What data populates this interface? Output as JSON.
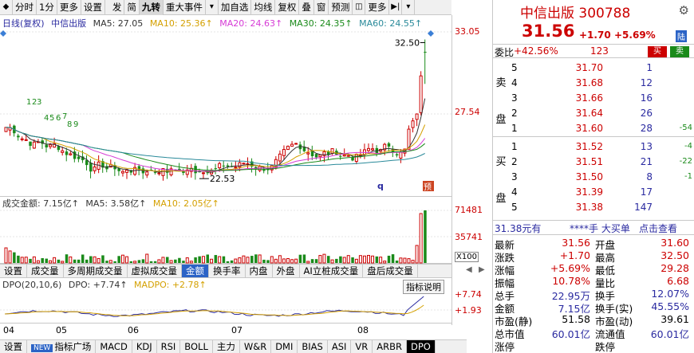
{
  "toolbar": {
    "items": [
      {
        "label": "◆",
        "kind": "arrow"
      },
      {
        "label": "分时"
      },
      {
        "label": "1分"
      },
      {
        "label": "更多"
      },
      {
        "label": "设置"
      },
      {
        "label": "",
        "kind": "gap"
      },
      {
        "label": "发"
      },
      {
        "label": "简"
      },
      {
        "label": "九转",
        "selected": true
      },
      {
        "label": "重大事件"
      },
      {
        "label": "▾",
        "kind": "arrow"
      },
      {
        "label": "加自选"
      },
      {
        "label": "均线"
      },
      {
        "label": "复权"
      },
      {
        "label": "叠"
      },
      {
        "label": "窗"
      },
      {
        "label": "预测"
      },
      {
        "label": "◫",
        "kind": "arrow"
      },
      {
        "label": "更多"
      },
      {
        "label": "▶|",
        "kind": "arrow"
      },
      {
        "label": "▾",
        "kind": "arrow"
      }
    ]
  },
  "kline": {
    "legend": {
      "mode": "日线(复权)",
      "name": "中信出版",
      "ma5": "MA5: 27.05",
      "ma10": "MA10: 25.36↑",
      "ma20": "MA20: 24.63↑",
      "ma30": "MA30: 24.35↑",
      "ma60": "MA60: 24.55↑"
    },
    "y_labels": [
      "33.05",
      "27.54"
    ],
    "high_label": "32.50",
    "low_label": "22.53",
    "nine_turn_labels": [
      "1",
      "2",
      "3",
      "4",
      "5",
      "6",
      "7",
      "8",
      "9"
    ],
    "marker_q": "q",
    "marker_box": "预"
  },
  "volume": {
    "legend": {
      "title": "成交金额: 7.15亿↑",
      "ma5": "MA5: 3.58亿↑",
      "ma10": "MA10: 2.05亿↑"
    },
    "y_labels": [
      "71481",
      "35741"
    ],
    "unit": "X100"
  },
  "subtabs": [
    {
      "label": "设置"
    },
    {
      "label": "成交量"
    },
    {
      "label": "多周期成交量"
    },
    {
      "label": "虚拟成交量"
    },
    {
      "label": "金额",
      "selected": true
    },
    {
      "label": "换手率"
    },
    {
      "label": "内盘"
    },
    {
      "label": "外盘"
    },
    {
      "label": "AI立桩成交量"
    },
    {
      "label": "盘后成交量"
    }
  ],
  "dpo": {
    "legend": {
      "title": "DPO(20,10,6)",
      "dpo": "DPO: +7.74↑",
      "madpo": "MADPO: +2.78↑"
    },
    "button": "指标说明",
    "y_labels": [
      "+7.74",
      "+1.93"
    ]
  },
  "dates": [
    "04",
    "05",
    "06",
    "07",
    "08"
  ],
  "bottombar": [
    {
      "label": "设置"
    },
    {
      "label": "指标广场",
      "new": "NEW"
    },
    {
      "label": "MACD"
    },
    {
      "label": "KDJ"
    },
    {
      "label": "RSI"
    },
    {
      "label": "BOLL"
    },
    {
      "label": "主力"
    },
    {
      "label": "W&R"
    },
    {
      "label": "DMI"
    },
    {
      "label": "BIAS"
    },
    {
      "label": "ASI"
    },
    {
      "label": "VR"
    },
    {
      "label": "ARBR"
    },
    {
      "label": "DPO",
      "selected": true
    }
  ],
  "quote": {
    "name": "中信出版  300788",
    "price": "31.56",
    "change": "+1.70",
    "change_pct": "+5.69%",
    "market": "陆",
    "weibi_label": "委比",
    "weibi_value": "+42.56%",
    "weicha": "123",
    "buy_btn": "买",
    "sell_btn": "卖",
    "sell_side_label": "卖盘",
    "buy_side_label": "买盘",
    "asks": [
      {
        "level": "5",
        "price": "31.70",
        "vol": "1",
        "delta": ""
      },
      {
        "level": "4",
        "price": "31.68",
        "vol": "12",
        "delta": ""
      },
      {
        "level": "3",
        "price": "31.66",
        "vol": "16",
        "delta": ""
      },
      {
        "level": "2",
        "price": "31.64",
        "vol": "26",
        "delta": ""
      },
      {
        "level": "1",
        "price": "31.60",
        "vol": "28",
        "delta": "-54"
      }
    ],
    "bids": [
      {
        "level": "1",
        "price": "31.52",
        "vol": "13",
        "delta": "-4"
      },
      {
        "level": "2",
        "price": "31.51",
        "vol": "21",
        "delta": "-22"
      },
      {
        "level": "3",
        "price": "31.50",
        "vol": "8",
        "delta": "-1"
      },
      {
        "level": "4",
        "price": "31.39",
        "vol": "17",
        "delta": ""
      },
      {
        "level": "5",
        "price": "31.38",
        "vol": "147",
        "delta": ""
      }
    ],
    "deal": {
      "a": "31.38元有",
      "b": "****手 大买单",
      "c": "点击查看"
    },
    "stats": [
      {
        "k1": "最新",
        "v1": "31.56",
        "c1": "red",
        "k2": "开盘",
        "v2": "31.60",
        "c2": "red"
      },
      {
        "k1": "涨跌",
        "v1": "+1.70",
        "c1": "red",
        "k2": "最高",
        "v2": "32.50",
        "c2": "red"
      },
      {
        "k1": "涨幅",
        "v1": "+5.69%",
        "c1": "red",
        "k2": "最低",
        "v2": "29.28",
        "c2": "red"
      },
      {
        "k1": "振幅",
        "v1": "10.78%",
        "c1": "red",
        "k2": "量比",
        "v2": "6.68",
        "c2": "red"
      },
      {
        "k1": "总手",
        "v1": "22.95万",
        "c1": "blue",
        "k2": "换手",
        "v2": "12.07%",
        "c2": "blue"
      },
      {
        "k1": "金额",
        "v1": "7.15亿",
        "c1": "blue",
        "k2": "换手(实)",
        "v2": "45.55%",
        "c2": "blue"
      },
      {
        "k1": "市盈(静)",
        "v1": "51.58",
        "c1": "",
        "k2": "市盈(动)",
        "v2": "39.61",
        "c2": ""
      },
      {
        "k1": "总市值",
        "v1": "60.01亿",
        "c1": "blue",
        "k2": "流通值",
        "v2": "60.01亿",
        "c2": "blue"
      },
      {
        "k1": "涨停",
        "v1": "",
        "c1": "",
        "k2": "跌停",
        "v2": "",
        "c2": ""
      }
    ]
  },
  "colors": {
    "up": "#cc0000",
    "down": "#1a8a1a",
    "ma5": "#333333",
    "ma10": "#d4a000",
    "ma20": "#d63bd6",
    "ma30": "#1a8a1a",
    "ma60": "#2a8a9a"
  }
}
